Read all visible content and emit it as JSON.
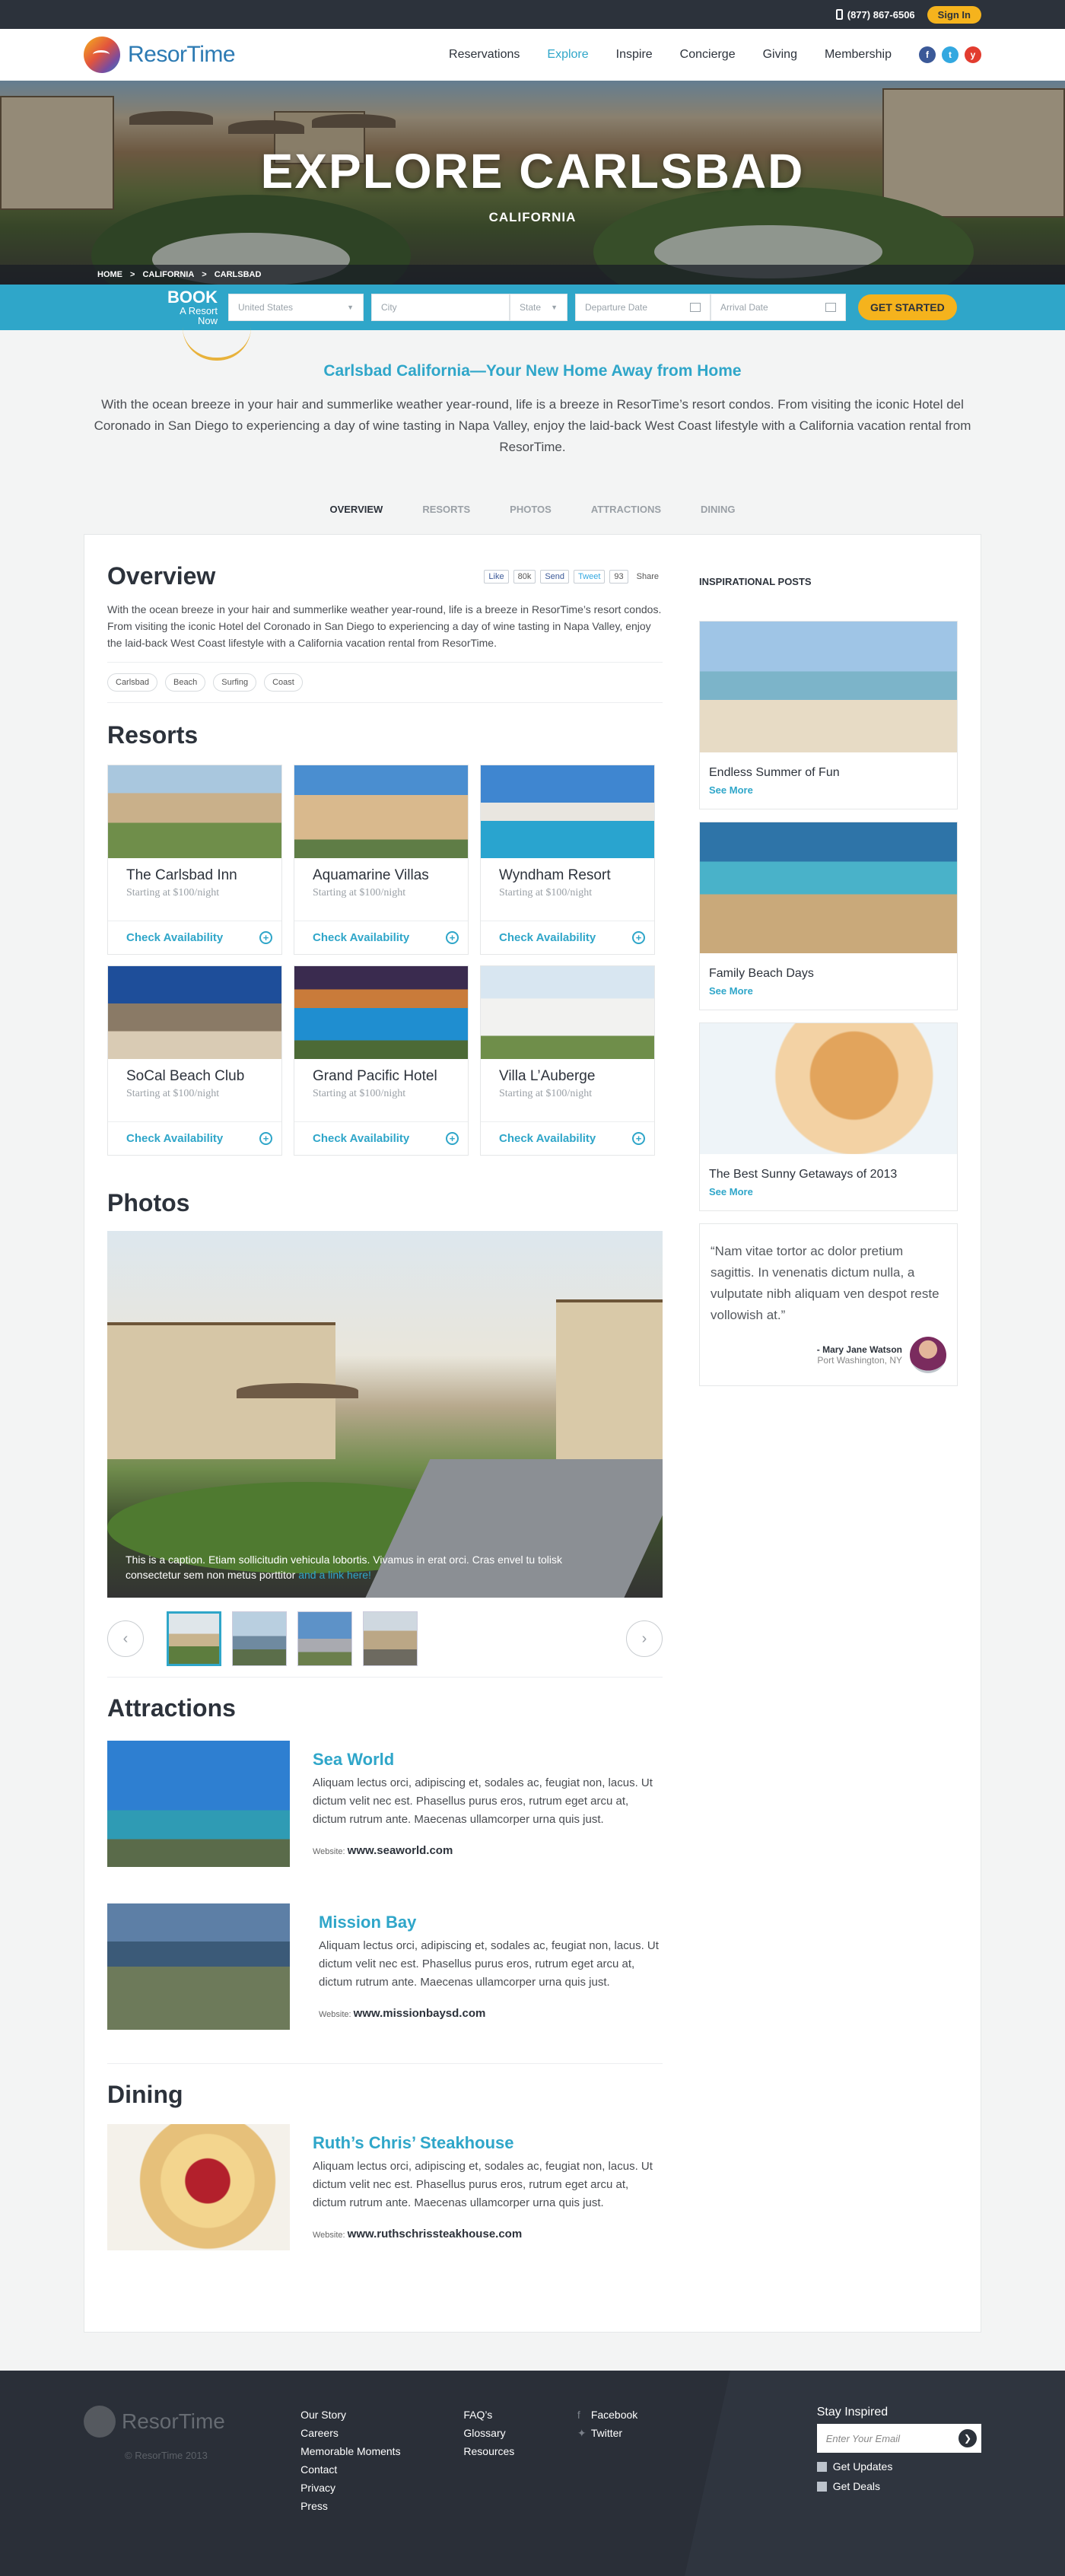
{
  "topbar": {
    "phone": "(877) 867-6506",
    "signin": "Sign In"
  },
  "nav": {
    "logo": "ResorTime",
    "items": [
      "Reservations",
      "Explore",
      "Inspire",
      "Concierge",
      "Giving",
      "Membership"
    ],
    "active": "Explore",
    "social": [
      "f",
      "t",
      "y"
    ]
  },
  "hero": {
    "title": "EXPLORE CARLSBAD",
    "subtitle": "CALIFORNIA",
    "breadcrumb": [
      "HOME",
      "CALIFORNIA",
      "CARLSBAD"
    ]
  },
  "booking": {
    "label_top": "BOOK",
    "label_bottom": "A Resort Now",
    "country": "United States",
    "city": "City",
    "state": "State",
    "departure": "Departure Date",
    "arrival": "Arrival Date",
    "cta": "GET STARTED"
  },
  "intro": {
    "heading": "Carlsbad California—Your New Home Away from Home",
    "text": "With the ocean breeze in your hair and summerlike weather year-round, life is a breeze in ResorTime’s resort condos. From visiting the iconic Hotel del Coronado in San Diego to experiencing a day of wine tasting in Napa Valley, enjoy the laid-back West Coast lifestyle with a California vacation rental from ResorTime."
  },
  "tabs": [
    "OVERVIEW",
    "RESORTS",
    "PHOTOS",
    "ATTRACTIONS",
    "DINING"
  ],
  "overview": {
    "title": "Overview",
    "share": {
      "like": "Like",
      "like_count": "80k",
      "send": "Send",
      "tweet": "Tweet",
      "tweet_count": "93",
      "share": "Share"
    },
    "text": "With the ocean breeze in your hair and summerlike weather year-round, life is a breeze in ResorTime’s resort condos. From visiting the iconic Hotel del Coronado in San Diego to experiencing a day of wine tasting in Napa Valley, enjoy the laid-back West Coast lifestyle with a California vacation rental from ResorTime.",
    "tags": [
      "Carlsbad",
      "Beach",
      "Surfing",
      "Coast"
    ]
  },
  "resorts": {
    "title": "Resorts",
    "cta": "Check Availability",
    "items": [
      {
        "name": "The Carlsbad Inn",
        "price": "Starting at $100/night"
      },
      {
        "name": "Aquamarine Villas",
        "price": "Starting at $100/night"
      },
      {
        "name": "Wyndham Resort",
        "price": "Starting at $100/night"
      },
      {
        "name": "SoCal Beach Club",
        "price": "Starting at $100/night"
      },
      {
        "name": "Grand Pacific Hotel",
        "price": "Starting at $100/night"
      },
      {
        "name": "Villa L’Auberge",
        "price": "Starting at $100/night"
      }
    ]
  },
  "photos": {
    "title": "Photos",
    "caption": "This is a caption. Etiam sollicitudin vehicula lobortis. Vivamus in erat orci. Cras envel tu tolisk consectetur sem non metus porttitor",
    "caption_link": "and a link here!"
  },
  "attractions": {
    "title": "Attractions",
    "items": [
      {
        "name": "Sea World",
        "text": "Aliquam lectus orci, adipiscing et, sodales ac, feugiat non, lacus. Ut dictum velit nec est. Phasellus purus eros, rutrum eget arcu at, dictum rutrum ante. Maecenas ullamcorper urna quis just.",
        "web_label": "Website:",
        "web": "www.seaworld.com"
      },
      {
        "name": "Mission Bay",
        "text": "Aliquam lectus orci, adipiscing et, sodales ac, feugiat non, lacus. Ut dictum velit nec est. Phasellus purus eros, rutrum eget arcu at, dictum rutrum ante. Maecenas ullamcorper urna quis just.",
        "web_label": "Website:",
        "web": "www.missionbaysd.com"
      }
    ]
  },
  "dining": {
    "title": "Dining",
    "items": [
      {
        "name": "Ruth’s Chris’ Steakhouse",
        "text": "Aliquam lectus orci, adipiscing et, sodales ac, feugiat non, lacus. Ut dictum velit nec est. Phasellus purus eros, rutrum eget arcu at, dictum rutrum ante. Maecenas ullamcorper urna quis just.",
        "web_label": "Website:",
        "web": "www.ruthschrissteakhouse.com"
      }
    ]
  },
  "sidebar": {
    "title": "INSPIRATIONAL POSTS",
    "more": "See More",
    "posts": [
      "Endless Summer of Fun",
      "Family Beach Days",
      "The Best Sunny Getaways of 2013"
    ],
    "quote": "“Nam vitae tortor ac dolor pretium sagittis. In venenatis dictum nulla, a vulputate nibh aliquam ven despot reste vollowish at.”",
    "author": "- Mary Jane Watson",
    "location": "Port Washington, NY"
  },
  "footer": {
    "logo": "ResorTime",
    "copyright": "© ResorTime 2013",
    "col1": [
      "Our Story",
      "Careers",
      "Memorable Moments",
      "Contact",
      "Privacy",
      "Press"
    ],
    "col2": [
      "FAQ’s",
      "Glossary",
      "Resources"
    ],
    "social": [
      "Facebook",
      "Twitter"
    ],
    "stay_title": "Stay Inspired",
    "email_placeholder": "Enter Your Email",
    "options": [
      "Get Updates",
      "Get Deals"
    ]
  },
  "colors": {
    "accent": "#2fa6c9",
    "brand_yellow": "#f5b31d",
    "dark": "#2c323b"
  }
}
